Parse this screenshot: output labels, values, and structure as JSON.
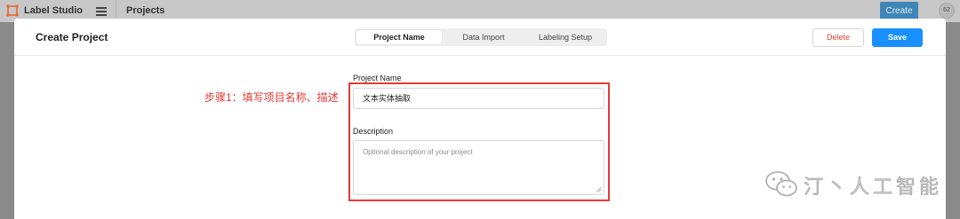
{
  "topbar": {
    "app_name": "Label Studio",
    "breadcrumb": "Projects",
    "create_label": "Create",
    "avatar_text": "62"
  },
  "modal": {
    "title": "Create Project",
    "tabs": [
      {
        "label": "Project Name",
        "active": true
      },
      {
        "label": "Data Import",
        "active": false
      },
      {
        "label": "Labeling Setup",
        "active": false
      }
    ],
    "delete_label": "Delete",
    "save_label": "Save"
  },
  "form": {
    "name_label": "Project Name",
    "name_value": "文本实体抽取",
    "description_label": "Description",
    "description_placeholder": "Optional description of your project"
  },
  "annotation": {
    "text": "步骤1：填写项目名称、描述",
    "color": "#e53935"
  },
  "watermark": {
    "text": "汀丶人工智能"
  },
  "colors": {
    "primary": "#1890ff",
    "danger": "#e0453a",
    "highlight": "#e53935"
  }
}
